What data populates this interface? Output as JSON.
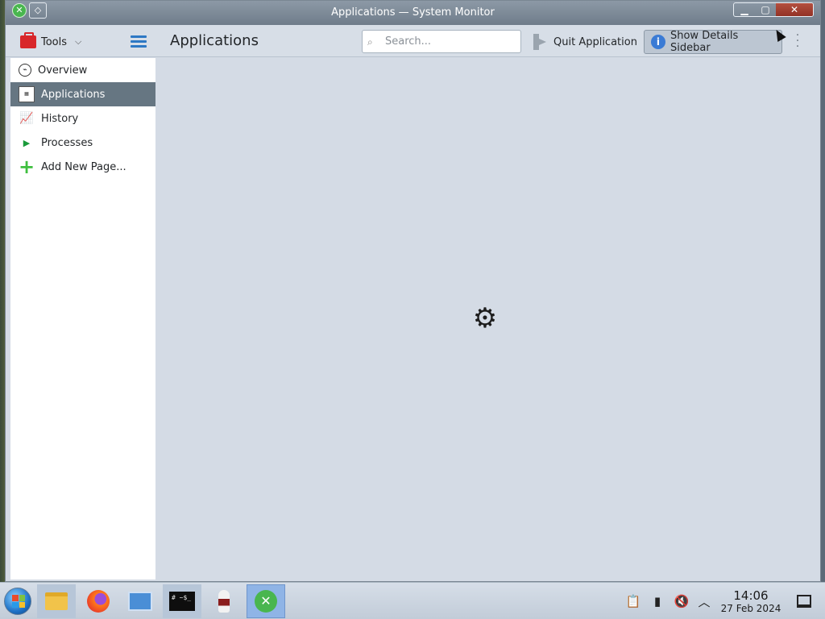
{
  "window": {
    "title": "Applications — System Monitor"
  },
  "header": {
    "tools_label": "Tools",
    "page_title": "Applications",
    "search_placeholder": "Search...",
    "quit_label": "Quit Application",
    "details_label": "Show Details Sidebar"
  },
  "sidebar": {
    "items": [
      {
        "label": "Overview",
        "icon": "gauge-icon"
      },
      {
        "label": "Applications",
        "icon": "applications-grid-icon"
      },
      {
        "label": "History",
        "icon": "chart-line-icon"
      },
      {
        "label": "Processes",
        "icon": "process-icon"
      },
      {
        "label": "Add New Page...",
        "icon": "plus-icon"
      }
    ],
    "active_index": 1
  },
  "content": {
    "status": "loading",
    "indicator_icon": "gear-busy-icon"
  },
  "taskbar": {
    "apps": [
      "file-manager",
      "firefox",
      "network",
      "terminal",
      "wine",
      "system-monitor"
    ],
    "active_app": "system-monitor",
    "clock_time": "14:06",
    "clock_date": "27 Feb 2024",
    "terminal_text": "# ~$_"
  },
  "colors": {
    "accent": "#2d78c4",
    "sidebar_active": "#667682",
    "content_bg": "#d4dbe5"
  }
}
